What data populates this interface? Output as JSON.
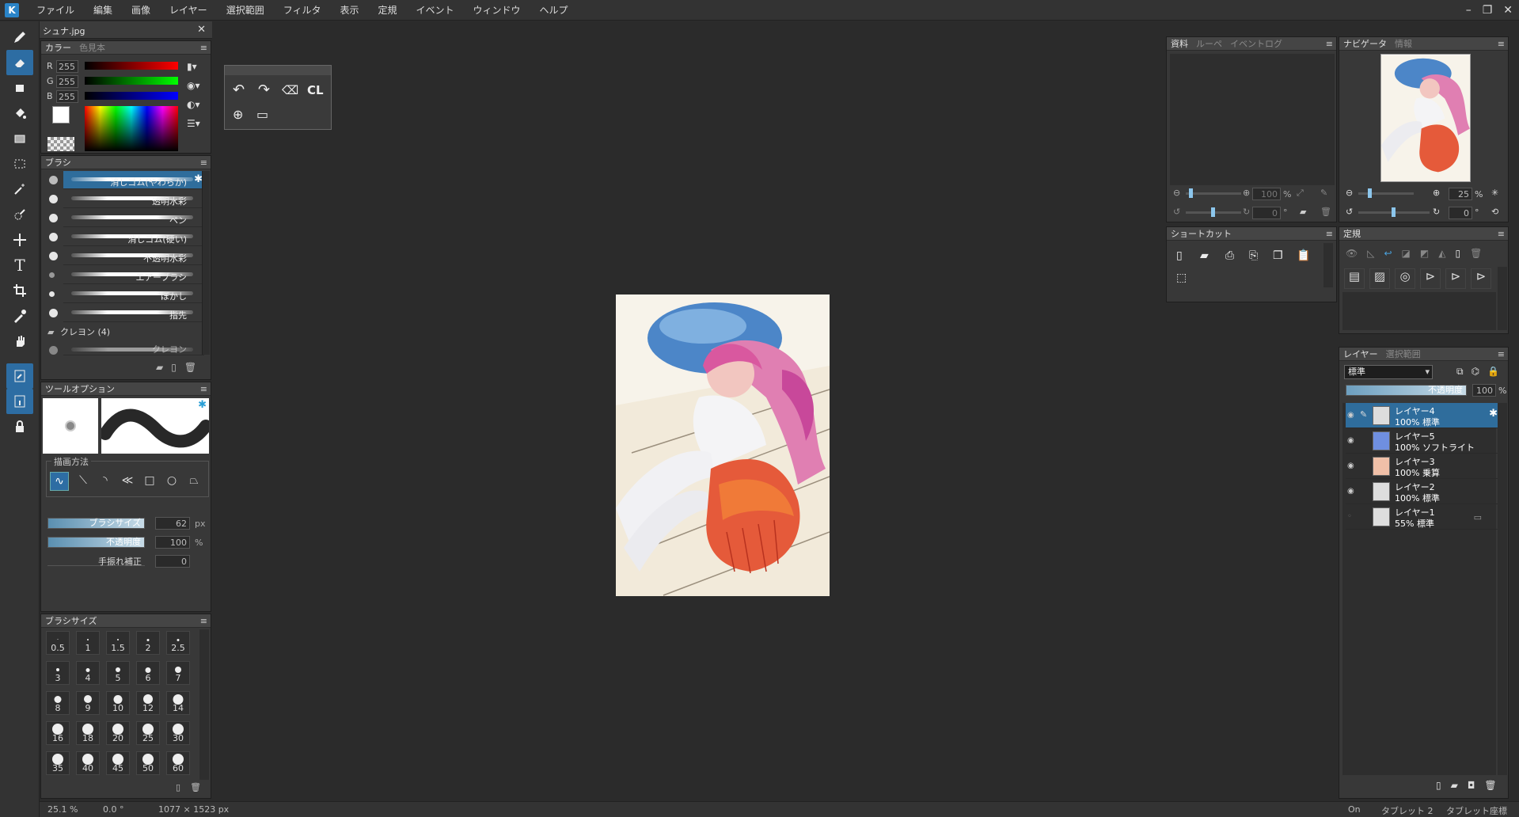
{
  "menu": {
    "logo": "K",
    "items": [
      "ファイル",
      "編集",
      "画像",
      "レイヤー",
      "選択範囲",
      "フィルタ",
      "表示",
      "定規",
      "イベント",
      "ウィンドウ",
      "ヘルプ"
    ],
    "window_controls": [
      "–",
      "❐",
      "✕"
    ]
  },
  "document_tab": {
    "title": "シュナ.jpg",
    "close": "✕"
  },
  "color_panel": {
    "tabs": [
      "カラー",
      "色見本"
    ],
    "r_label": "R",
    "g_label": "G",
    "b_label": "B",
    "r": "255",
    "g": "255",
    "b": "255"
  },
  "brush_panel": {
    "title": "ブラシ",
    "brushes": [
      "消しゴム(やわらか)",
      "透明水彩",
      "ペン",
      "消しゴム(硬い)",
      "不透明水彩",
      "エアーブラシ",
      "ぼかし",
      "指先"
    ],
    "group": "クレヨン (4)",
    "group_item": "クレヨン"
  },
  "tool_options": {
    "title": "ツールオプション",
    "draw_method_label": "描画方法",
    "brush_size_label": "ブラシサイズ",
    "brush_size": "62",
    "brush_size_unit": "px",
    "opacity_label": "不透明度",
    "opacity": "100",
    "opacity_unit": "%",
    "stabilizer_label": "手振れ補正",
    "stabilizer": "0"
  },
  "brush_size_panel": {
    "title": "ブラシサイズ",
    "sizes": [
      "0.5",
      "1",
      "1.5",
      "2",
      "2.5",
      "3",
      "4",
      "5",
      "6",
      "7",
      "8",
      "9",
      "10",
      "12",
      "14",
      "16",
      "18",
      "20",
      "25",
      "30",
      "35",
      "40",
      "45",
      "50",
      "60"
    ]
  },
  "quick_toolbar": {
    "cl_label": "CL"
  },
  "material_panel": {
    "tabs": [
      "資料",
      "ルーペ",
      "イベントログ"
    ],
    "zoom": "100",
    "zoom_unit": "%",
    "angle": "0",
    "angle_unit": "°"
  },
  "navigator_panel": {
    "tabs": [
      "ナビゲータ",
      "情報"
    ],
    "zoom": "25",
    "zoom_unit": "%",
    "angle": "0",
    "angle_unit": "°"
  },
  "shortcut_panel": {
    "title": "ショートカット"
  },
  "ruler_panel": {
    "title": "定規"
  },
  "layer_panel": {
    "tabs": [
      "レイヤー",
      "選択範囲"
    ],
    "blend_mode": "標準",
    "opacity_label": "不透明度",
    "opacity": "100",
    "opacity_unit": "%",
    "layers": [
      {
        "name": "レイヤー4",
        "info": "100% 標準"
      },
      {
        "name": "レイヤー5",
        "info": "100% ソフトライト"
      },
      {
        "name": "レイヤー3",
        "info": "100% 乗算"
      },
      {
        "name": "レイヤー2",
        "info": "100% 標準"
      },
      {
        "name": "レイヤー1",
        "info": "55% 標準"
      }
    ]
  },
  "status_bar": {
    "zoom": "25.1 %",
    "angle": "0.0 °",
    "size": "1077 × 1523 px",
    "right1": "On",
    "right2": "タブレット 2",
    "right3": "タブレット座標"
  },
  "colors": {
    "accent": "#2d6da3",
    "bg": "#2b2b2b",
    "panel": "#383838"
  }
}
